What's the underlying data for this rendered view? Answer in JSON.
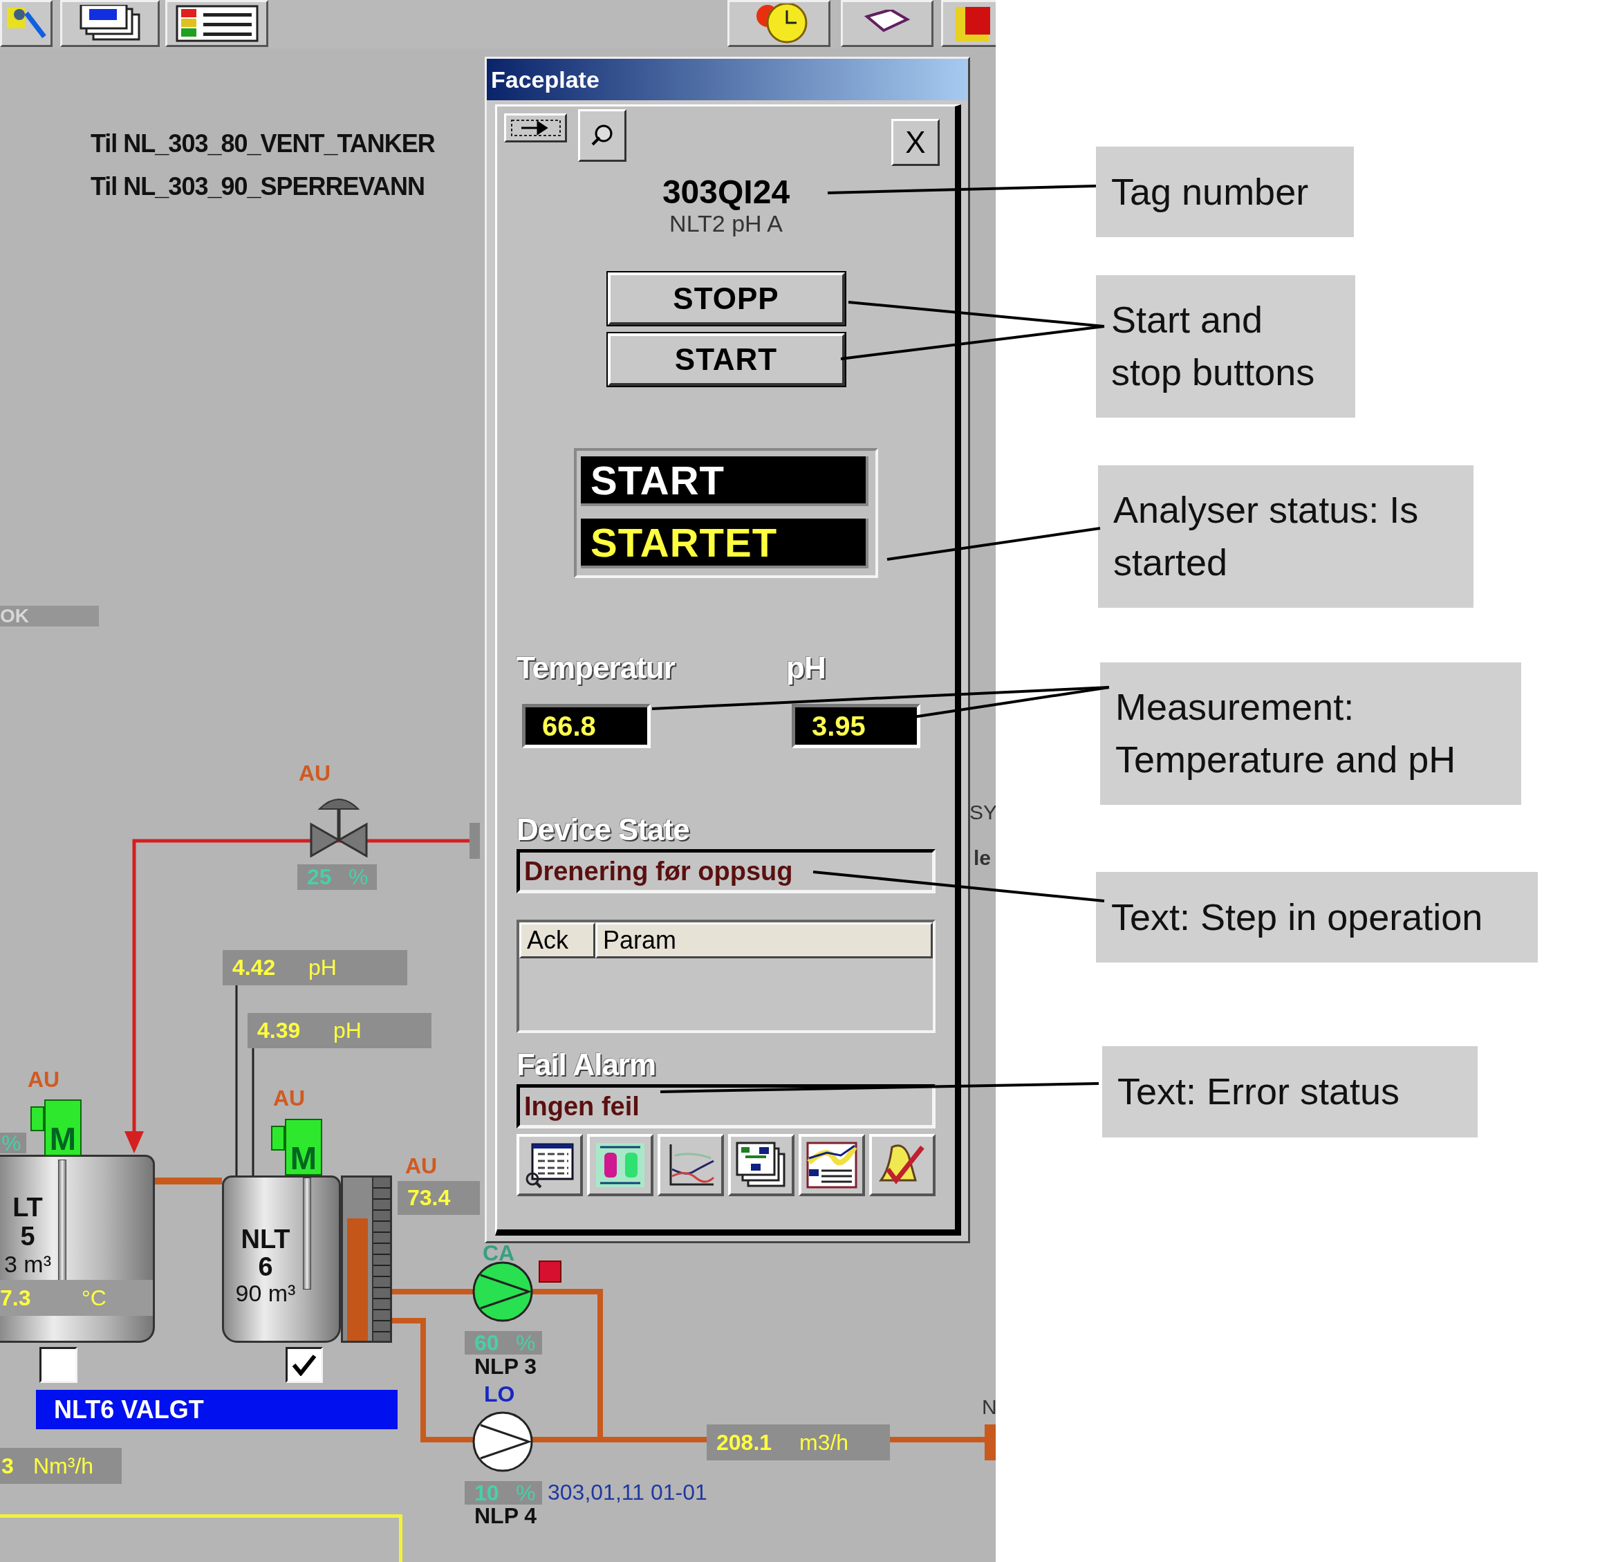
{
  "process": {
    "transfer_labels": [
      "Til NL_303_80_VENT_TANKER",
      "Til NL_303_90_SPERREVANN"
    ],
    "ok_label": "OK",
    "valve": {
      "mode": "AU",
      "reading": "25",
      "unit": "%"
    },
    "ph_readings": [
      {
        "value": "4.42",
        "unit": "pH"
      },
      {
        "value": "4.39",
        "unit": "pH"
      }
    ],
    "tanks": [
      {
        "mode": "AU",
        "motor_label": "M",
        "name_lines": [
          "LT",
          "5",
          "3 m³"
        ],
        "reading_unit": "%",
        "temperature": {
          "value": "7.3",
          "unit": "°C"
        },
        "checked": false
      },
      {
        "mode": "AU",
        "motor_label": "M",
        "name_lines": [
          "NLT",
          "6",
          "90 m³"
        ],
        "level": 0.75,
        "checked": true
      }
    ],
    "level_reading": {
      "mode": "AU",
      "value": "73.4"
    },
    "pumps": [
      {
        "mode": "CA",
        "running": true,
        "alarm": true,
        "reading": "60",
        "unit": "%",
        "name": "NLP 3"
      },
      {
        "mode": "LO",
        "running": false,
        "alarm": false,
        "reading": "10",
        "unit": "%",
        "name": "NLP 4",
        "address": "303,01,11 01-01"
      }
    ],
    "selection_banner": "NLT6 VALGT",
    "flow_reading": {
      "value": "208.1",
      "unit": "m3/h"
    },
    "gas_reading": {
      "value": "3",
      "unit": "Nm³/h"
    },
    "edge_labels": [
      "SY",
      "le",
      "N"
    ]
  },
  "faceplate": {
    "title": "Faceplate",
    "close": "X",
    "tag": "303QI24",
    "description": "NLT2 pH A",
    "buttons": [
      "STOPP",
      "START"
    ],
    "command": "START",
    "feedback": "STARTET",
    "measurements": [
      {
        "label": "Temperatur",
        "value": "66.8"
      },
      {
        "label": "pH",
        "value": "3.95"
      }
    ],
    "device_state": {
      "label": "Device State",
      "value": "Drenering før oppsug"
    },
    "table": {
      "columns": [
        "Ack",
        "Param"
      ]
    },
    "fail_alarm": {
      "label": "Fail Alarm",
      "value": "Ingen feil"
    }
  },
  "annotations": [
    "Tag number",
    "Start and stop buttons",
    "Analyser status: Is started",
    "Measurement: Temperature and pH",
    "Text: Step in operation",
    "Text: Error status"
  ]
}
